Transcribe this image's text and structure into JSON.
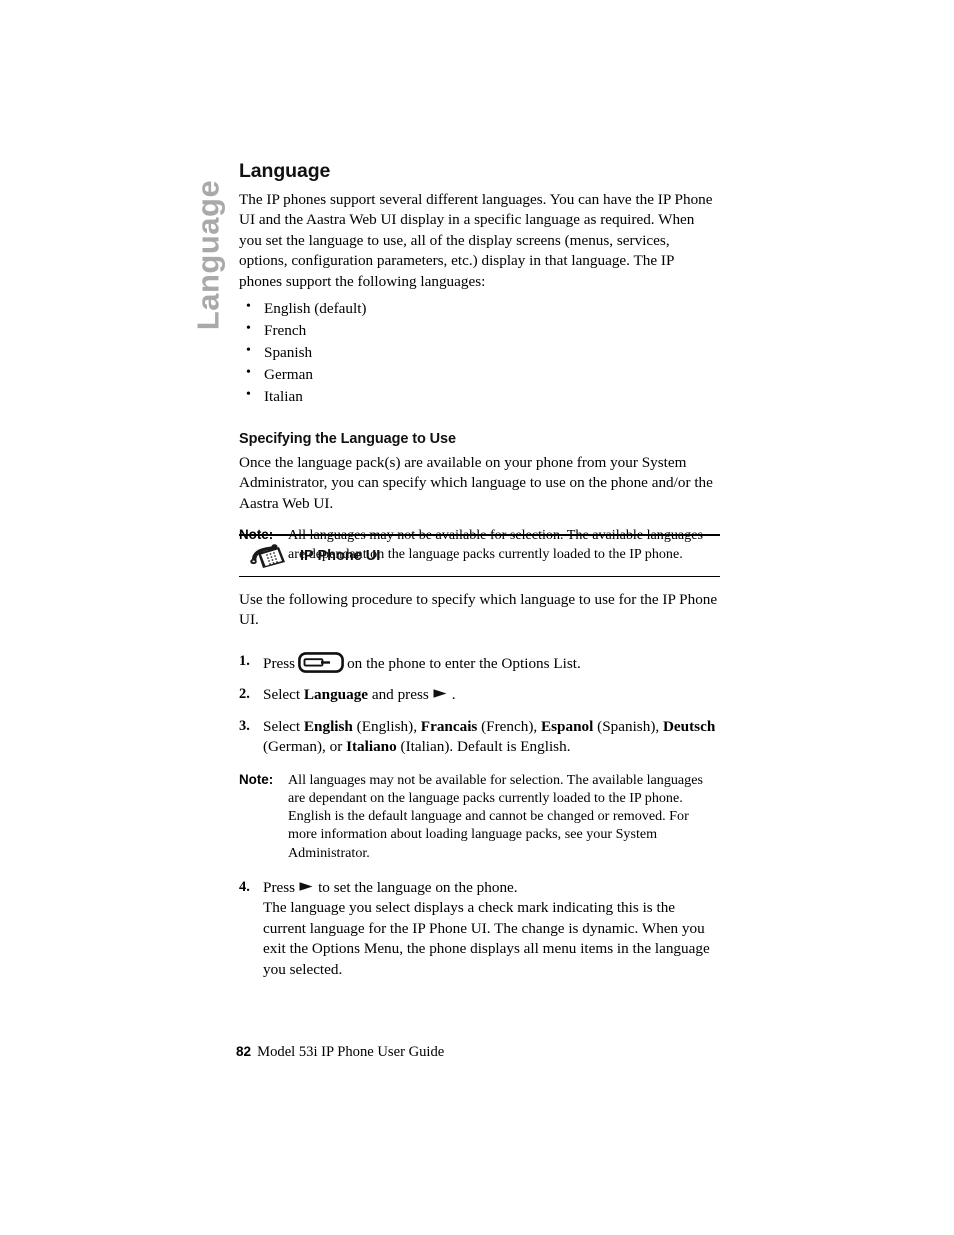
{
  "side_tab": {
    "label": "Language",
    "color": "#a9a9a9"
  },
  "section": {
    "title": "Language",
    "intro": "The IP phones support several different languages. You can have the IP Phone UI and the Aastra Web UI display in a specific language as required. When you set the language to use, all of the display screens (menus, services, options, configuration parameters, etc.) display in that language. The IP phones support the following languages:",
    "languages": [
      "English (default)",
      "French",
      "Spanish",
      "German",
      "Italian"
    ]
  },
  "subsection": {
    "title": "Specifying the Language to Use",
    "intro": "Once the language pack(s) are available on your phone from your System Administrator, you can specify which language to use on the phone and/or the Aastra Web UI.",
    "note_label": "Note:",
    "note_text": "All languages may not be available for selection. The available languages are dependant on the language packs currently loaded to the IP phone."
  },
  "banner": {
    "label": "IP Phone UI",
    "icon": "desk-phone-icon"
  },
  "procedure": {
    "intro": "Use the following procedure to specify which language to use for the IP Phone UI.",
    "step1": {
      "number": "1.",
      "text_before": "Press",
      "icon": "options-key-icon",
      "text_after": "on the phone to enter the Options List."
    },
    "step2": {
      "number": "2.",
      "text_before": "Select",
      "bold_term": "Language",
      "text_middle": "and press",
      "icon": "right-arrow-key-icon",
      "text_after": "."
    },
    "step3": {
      "number": "3.",
      "text_before": "Select",
      "t1": "English",
      "p1": "(English),",
      "t2": "Francais",
      "p2": "(French),",
      "t3": "Espanol",
      "p3": "(Spanish),",
      "t4": "Deutsch",
      "p4": "(German), or",
      "t5": "Italiano",
      "p5": "(Italian). Default is English."
    },
    "step3_note": {
      "label": "Note:",
      "text": "All languages may not be available for selection. The available languages are dependant on the language packs currently loaded to the IP phone. English is the default language and cannot be changed or removed. For more information about loading language packs, see your System Administrator."
    },
    "step4": {
      "number": "4.",
      "text_before": "Press",
      "icon": "right-arrow-key-icon",
      "text_after": "to set the language on the phone.",
      "detail": "The language you select displays a check mark indicating this is the current language for the IP Phone UI. The change is dynamic. When you exit the Options Menu, the phone displays all menu items in the language you selected."
    }
  },
  "footer": {
    "page_number": "82",
    "document_title": "Model 53i IP Phone User Guide"
  }
}
